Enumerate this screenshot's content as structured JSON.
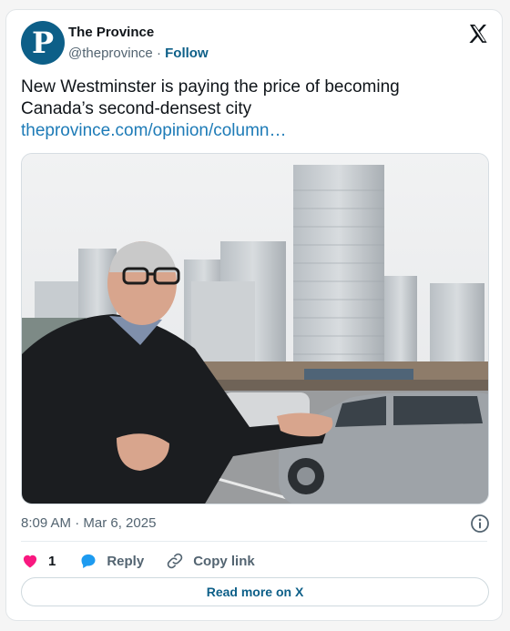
{
  "author": {
    "avatar_letter": "P",
    "name": "The Province",
    "handle": "@theprovince",
    "separator": "·",
    "follow_label": "Follow"
  },
  "tweet": {
    "text": "New Westminster is paying the price of becoming Canada’s second-densest city",
    "link": "theprovince.com/opinion/column…"
  },
  "media": {
    "icon": "photo",
    "description": "photo of a man gesturing in front of high-rise towers and parked cars"
  },
  "meta": {
    "timestamp": "8:09 AM · Mar 6, 2025"
  },
  "actions": {
    "like_count": "1",
    "reply_label": "Reply",
    "copy_label": "Copy link"
  },
  "read_more_label": "Read more on X",
  "colors": {
    "brand": "#0d5f88",
    "link": "#1d7bb7",
    "heart": "#f91880",
    "reply": "#1d9bf0",
    "muted": "#536471"
  }
}
